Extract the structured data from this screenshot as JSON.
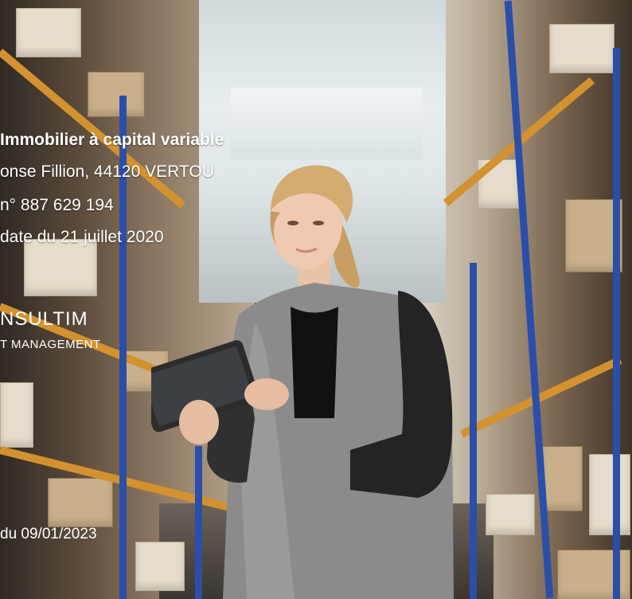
{
  "company": {
    "legal_form_line": "Immobilier à capital variable",
    "address_line": "onse Fillion, 44120 VERTOU",
    "registration_line": "n° 887 629 194",
    "update_line": "date du 21 juillet 2020"
  },
  "logo": {
    "name": "NSULTIM",
    "tagline": "T MANAGEMENT"
  },
  "footer": {
    "date_line": "du 09/01/2023"
  }
}
